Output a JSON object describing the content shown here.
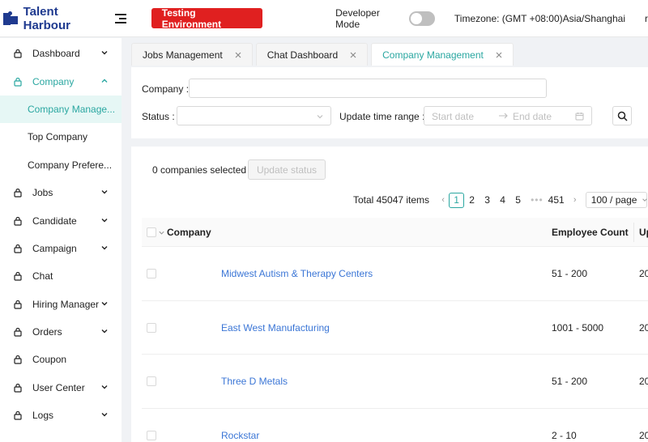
{
  "header": {
    "brand": "Talent Harbour",
    "env_label": "Testing Environment",
    "dev_mode_label": "Developer Mode",
    "timezone": "Timezone: (GMT +08:00)Asia/Shanghai",
    "user_initial": "r"
  },
  "sidebar": {
    "items": [
      {
        "label": "Dashboard"
      },
      {
        "label": "Company"
      },
      {
        "label": "Jobs"
      },
      {
        "label": "Candidate"
      },
      {
        "label": "Campaign"
      },
      {
        "label": "Chat"
      },
      {
        "label": "Hiring Manager"
      },
      {
        "label": "Orders"
      },
      {
        "label": "Coupon"
      },
      {
        "label": "User Center"
      },
      {
        "label": "Logs"
      }
    ],
    "company_sub": [
      {
        "label": "Company Manage..."
      },
      {
        "label": "Top Company"
      },
      {
        "label": "Company Prefere..."
      }
    ]
  },
  "tabs": [
    {
      "label": "Jobs Management"
    },
    {
      "label": "Chat Dashboard"
    },
    {
      "label": "Company Management"
    }
  ],
  "filter": {
    "company_label": "Company",
    "status_label": "Status",
    "time_label": "Update time range",
    "start_placeholder": "Start date",
    "end_placeholder": "End date"
  },
  "toolbar": {
    "selected_text": "0 companies selected",
    "update_status_label": "Update status"
  },
  "pagination": {
    "total": "Total 45047 items",
    "pages": [
      "1",
      "2",
      "3",
      "4",
      "5"
    ],
    "ellipsis": "•••",
    "last_page": "451",
    "page_size": "100 / page"
  },
  "table": {
    "columns": [
      "Company",
      "Employee Count",
      "Up"
    ],
    "rows": [
      {
        "company": "Midwest Autism & Therapy Centers",
        "employees": "51 - 200",
        "updated": "20"
      },
      {
        "company": "East West Manufacturing",
        "employees": "1001 - 5000",
        "updated": "20"
      },
      {
        "company": "Three D Metals",
        "employees": "51 - 200",
        "updated": "20"
      },
      {
        "company": "Rockstar",
        "employees": "2 - 10",
        "updated": "20"
      }
    ]
  },
  "colors": {
    "brand": "#1f3a8f",
    "accent": "#2aa7a1",
    "env_red": "#e02020",
    "link": "#3b76d6"
  }
}
